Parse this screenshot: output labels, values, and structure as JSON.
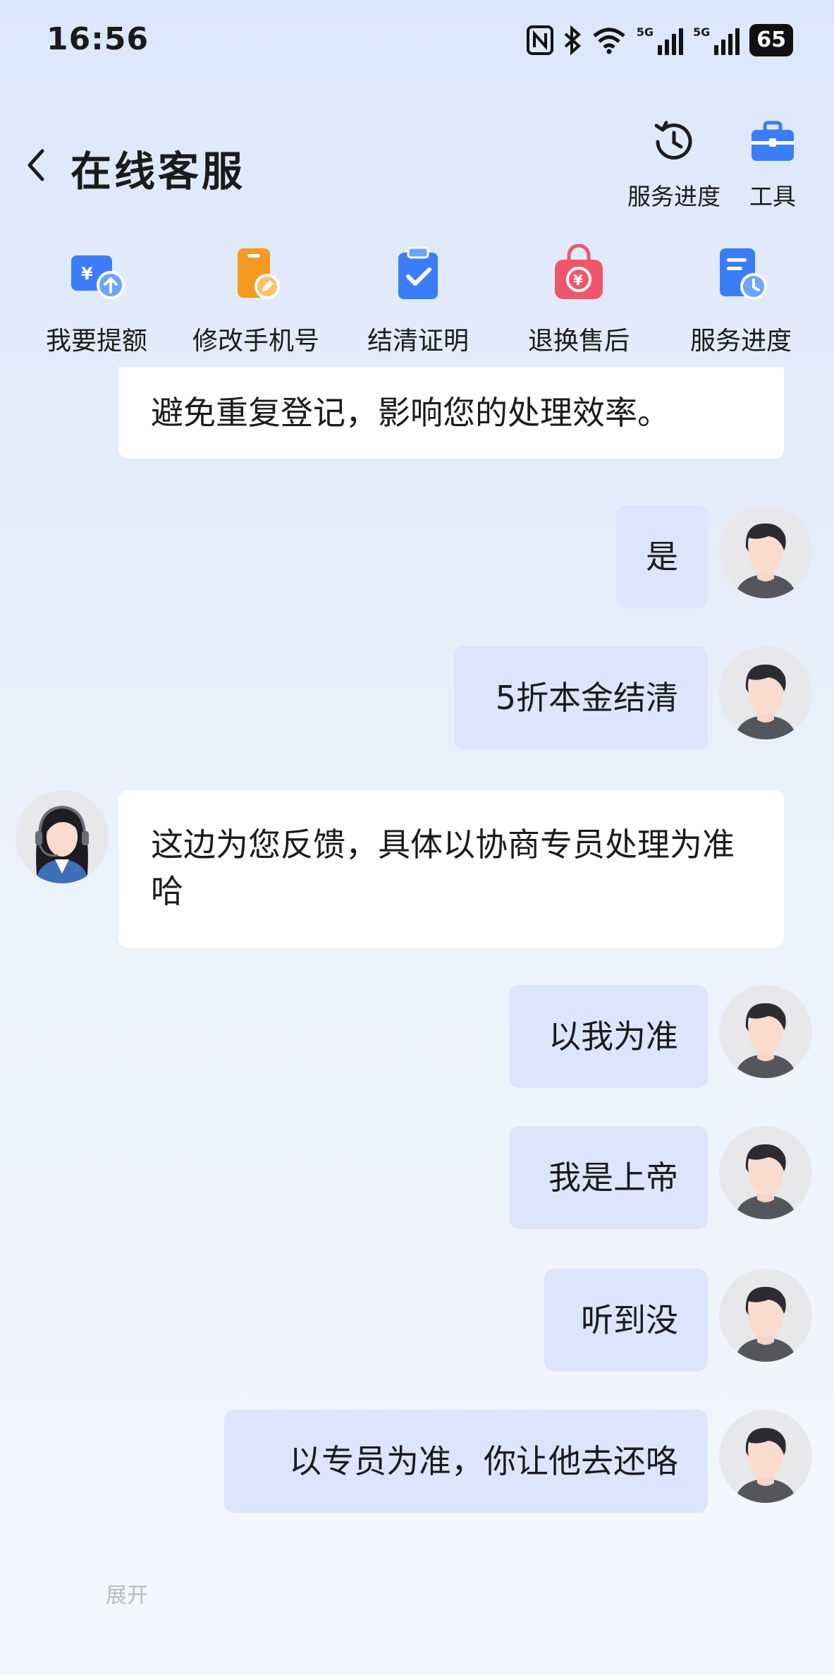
{
  "status_bar": {
    "time": "16:56",
    "network_label": "5G",
    "battery": "65",
    "icons": [
      "nfc-icon",
      "bluetooth-icon",
      "wifi-icon",
      "signal-icon",
      "signal-icon",
      "battery-icon"
    ]
  },
  "header": {
    "title": "在线客服",
    "actions": [
      {
        "label": "服务进度",
        "icon": "clock-history-icon"
      },
      {
        "label": "工具",
        "icon": "toolbox-icon"
      }
    ]
  },
  "quick_menu": [
    {
      "label": "我要提额",
      "icon": "wallet-up-icon",
      "color": "#3b7df6"
    },
    {
      "label": "修改手机号",
      "icon": "phone-edit-icon",
      "color": "#f59a23"
    },
    {
      "label": "结清证明",
      "icon": "clipboard-check-icon",
      "color": "#3b7df6"
    },
    {
      "label": "退换售后",
      "icon": "shopping-bag-refund-icon",
      "color": "#f0566b"
    },
    {
      "label": "服务进度",
      "icon": "document-clock-icon",
      "color": "#3b7df6"
    }
  ],
  "messages": [
    {
      "from": "agent",
      "text": "避免重复登记，影响您的处理效率。"
    },
    {
      "from": "user",
      "text": "是"
    },
    {
      "from": "user",
      "text": "5折本金结清"
    },
    {
      "from": "agent",
      "text": "这边为您反馈，具体以协商专员处理为准哈"
    },
    {
      "from": "user",
      "text": "以我为准"
    },
    {
      "from": "user",
      "text": "我是上帝"
    },
    {
      "from": "user",
      "text": "听到没"
    },
    {
      "from": "user",
      "text": "以专员为准，你让他去还咯"
    }
  ],
  "footer": {
    "expand_label": "展开"
  },
  "colors": {
    "accent": "#3b7df6",
    "user_bubble": "#dbe6fd",
    "agent_bubble": "#ffffff"
  }
}
